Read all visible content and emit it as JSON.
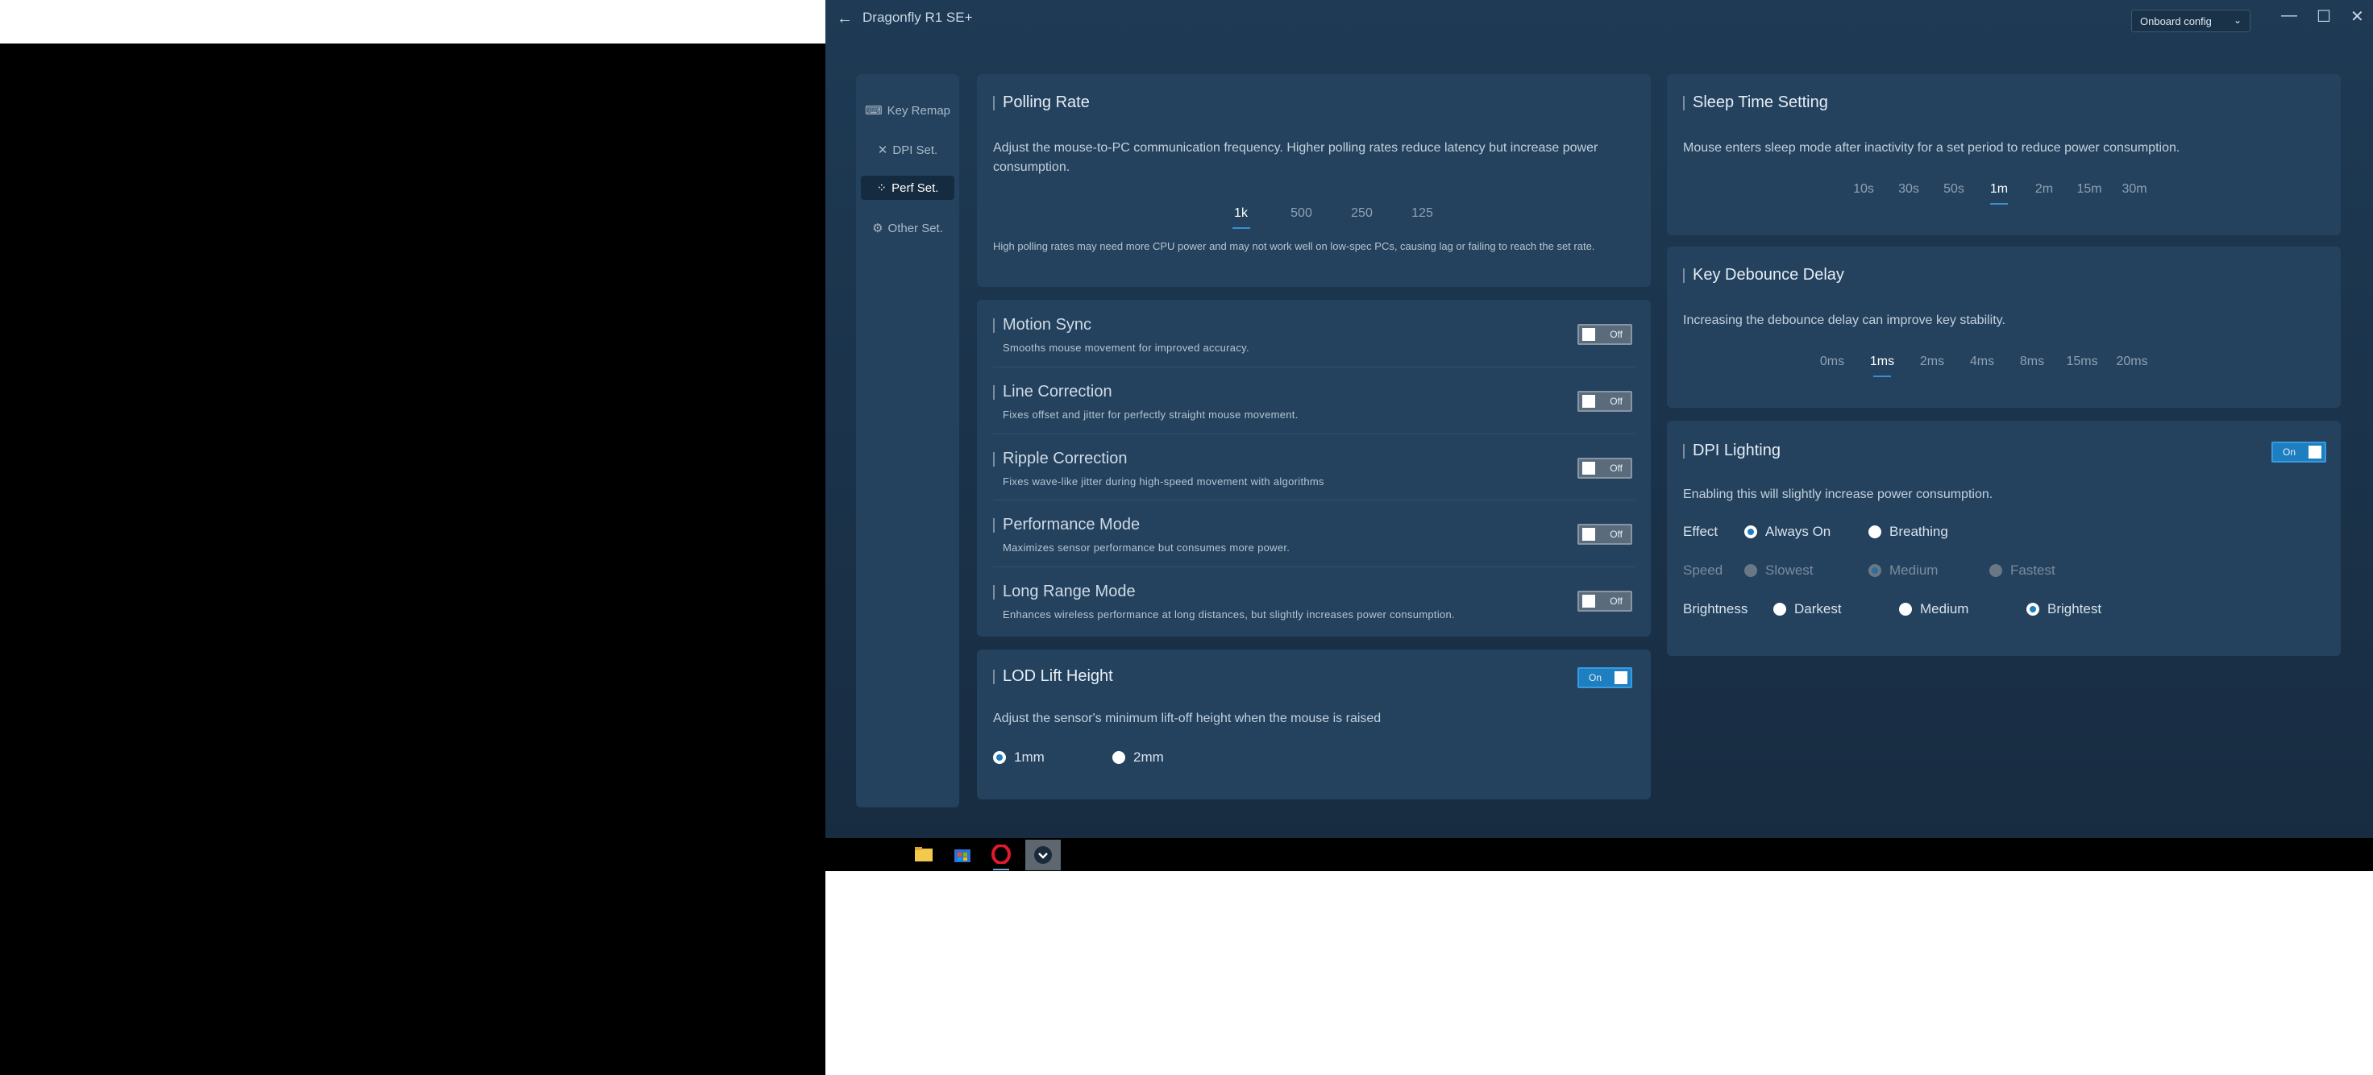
{
  "app": {
    "title": "Dragonfly R1 SE+",
    "config": "Onboard config",
    "accent": "#1d7ec0"
  },
  "nav": [
    {
      "label": "Key Remap",
      "icon": "keyboard-icon"
    },
    {
      "label": "DPI Set.",
      "icon": "crosshair-icon"
    },
    {
      "label": "Perf Set.",
      "icon": "performance-icon"
    },
    {
      "label": "Other Set.",
      "icon": "gear-icon"
    }
  ],
  "polling": {
    "title": "Polling Rate",
    "desc": "Adjust the mouse-to-PC communication frequency. Higher polling rates reduce latency but increase power consumption.",
    "options": [
      "1k",
      "500",
      "250",
      "125"
    ],
    "selected": "1k",
    "note": "High polling rates may need more CPU power and may not work well on low-spec PCs, causing lag or failing to reach the set rate."
  },
  "toggles": [
    {
      "title": "Motion Sync",
      "desc": "Smooths mouse movement for improved accuracy.",
      "state": "Off"
    },
    {
      "title": "Line Correction",
      "desc": "Fixes offset and jitter for perfectly straight mouse movement.",
      "state": "Off"
    },
    {
      "title": "Ripple Correction",
      "desc": "Fixes wave-like jitter during high-speed movement with algorithms",
      "state": "Off"
    },
    {
      "title": "Performance Mode",
      "desc": "Maximizes sensor performance but consumes more power.",
      "state": "Off"
    },
    {
      "title": "Long Range Mode",
      "desc": "Enhances wireless performance at long distances, but slightly increases power consumption.",
      "state": "Off"
    }
  ],
  "lod": {
    "title": "LOD Lift Height",
    "state": "On",
    "desc": "Adjust the sensor's minimum lift-off height when the mouse is raised",
    "options": [
      "1mm",
      "2mm"
    ],
    "selected": "1mm"
  },
  "sleep": {
    "title": "Sleep Time Setting",
    "desc": "Mouse enters sleep mode after inactivity for a set period to reduce power consumption.",
    "options": [
      "10s",
      "30s",
      "50s",
      "1m",
      "2m",
      "15m",
      "30m"
    ],
    "selected": "1m"
  },
  "debounce": {
    "title": "Key Debounce Delay",
    "desc": "Increasing the debounce delay can improve key stability.",
    "options": [
      "0ms",
      "1ms",
      "2ms",
      "4ms",
      "8ms",
      "15ms",
      "20ms"
    ],
    "selected": "1ms"
  },
  "dpi_lighting": {
    "title": "DPI Lighting",
    "state": "On",
    "desc": "Enabling this will slightly increase power consumption.",
    "effect_label": "Effect",
    "effect_options": [
      "Always On",
      "Breathing"
    ],
    "speed_label": "Speed",
    "speed_options": [
      "Slowest",
      "Medium",
      "Fastest"
    ],
    "brightness_label": "Brightness",
    "brightness_options": [
      "Darkest",
      "Medium",
      "Brightest"
    ]
  }
}
